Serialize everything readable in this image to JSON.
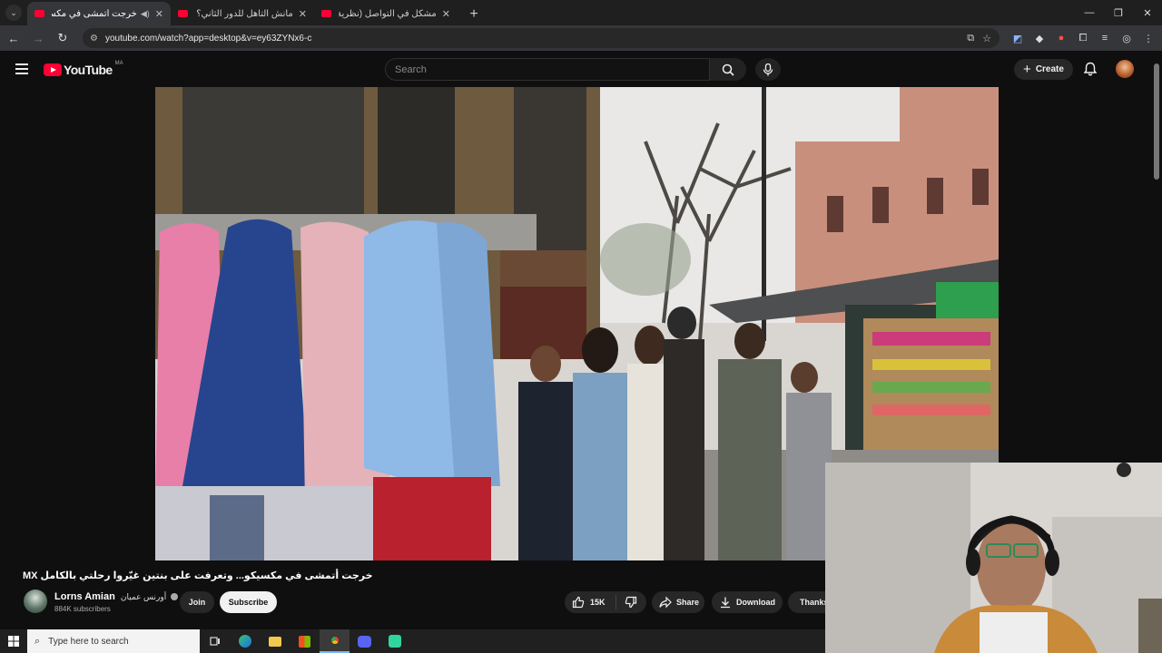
{
  "browser": {
    "tabs": [
      {
        "title": "خرجت أتمشى في مكسيكو... وتعرفت على بنتين غيّروا رحلتي",
        "active": true,
        "audio": true
      },
      {
        "title": "مانش التأهل للدور الثاني؟ التشكيلة",
        "active": false,
        "audio": false
      },
      {
        "title": "مشكل في التواصل (نظرية الزرّاكة)",
        "active": false,
        "audio": false
      }
    ],
    "url": "youtube.com/watch?app=desktop&v=ey63ZYNx6-c"
  },
  "youtube": {
    "logo_text": "YouTube",
    "country_code": "MA",
    "search_placeholder": "Search",
    "create_label": "Create"
  },
  "video": {
    "title": "خرجت أتمشى في مكسيكو... وتعرفت على بنتين غيّروا رحلتي بالكامل MX",
    "channel_name": "Lorns Amian",
    "channel_name_ar": "أورنس عميان",
    "subscribers": "884K subscribers",
    "join_label": "Join",
    "subscribe_label": "Subscribe",
    "likes": "15K",
    "share_label": "Share",
    "download_label": "Download",
    "thanks_label": "Thanks"
  },
  "taskbar": {
    "search_placeholder": "Type here to search"
  },
  "colors": {
    "yt_red": "#ff0033",
    "background": "#0f0f0f",
    "chip": "#272727"
  }
}
